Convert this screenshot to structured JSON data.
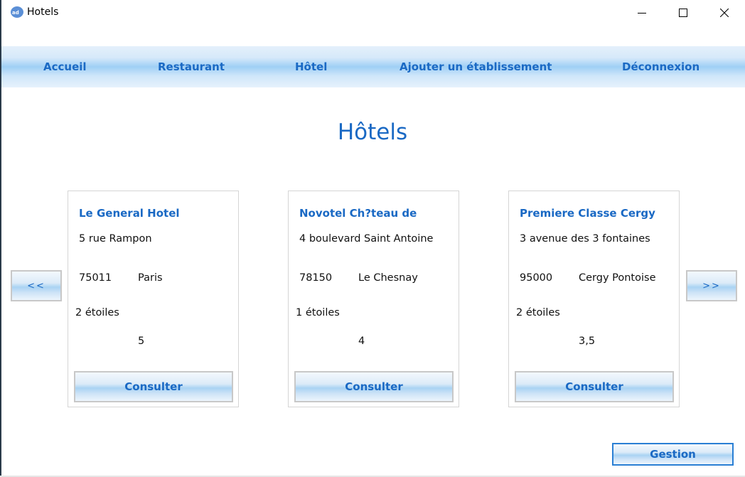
{
  "window": {
    "title": "Hotels",
    "icon": "app-icon"
  },
  "menu": [
    {
      "label": "Accueil"
    },
    {
      "label": "Restaurant"
    },
    {
      "label": "Hôtel"
    },
    {
      "label": "Ajouter un établissement"
    },
    {
      "label": "Déconnexion"
    }
  ],
  "page_title": "Hôtels",
  "nav": {
    "prev_label": "<<",
    "next_label": ">>"
  },
  "hotels": [
    {
      "name": "Le General Hotel",
      "address": "5 rue Rampon",
      "zip": "75011",
      "city": "Paris",
      "stars": "2 étoiles",
      "rating": "5",
      "button": "Consulter"
    },
    {
      "name": "Novotel Ch?teau de",
      "address": "4 boulevard Saint Antoine",
      "zip": "78150",
      "city": "Le Chesnay",
      "stars": "1 étoiles",
      "rating": "4",
      "button": "Consulter"
    },
    {
      "name": "Premiere Classe Cergy",
      "address": "3 avenue des 3 fontaines",
      "zip": "95000",
      "city": "Cergy Pontoise",
      "stars": "2 étoiles",
      "rating": "3,5",
      "button": "Consulter"
    }
  ],
  "gestion_label": "Gestion",
  "colors": {
    "accent": "#1a69c4",
    "menu_band": "#9fcff5",
    "border": "#c8c8c8"
  }
}
